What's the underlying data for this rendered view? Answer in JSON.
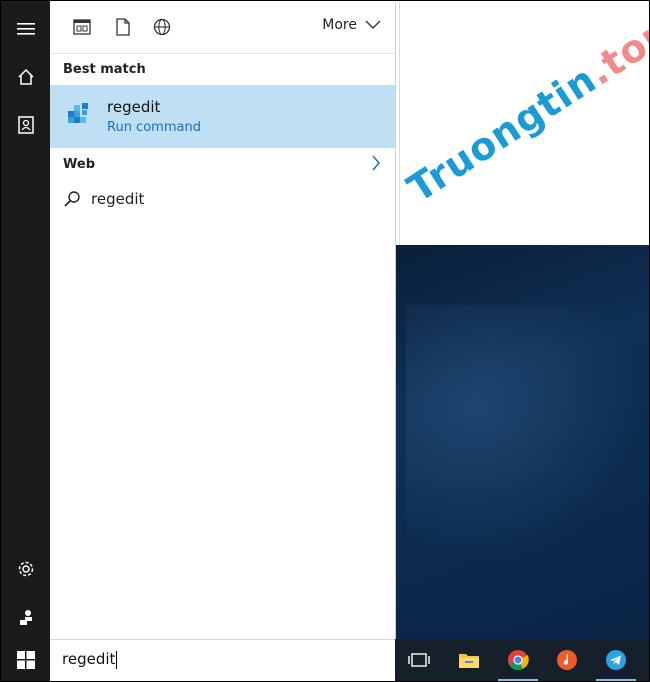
{
  "rail": {
    "items": [
      "menu-icon",
      "home-icon",
      "notebook-icon",
      "settings-icon",
      "feedback-icon"
    ]
  },
  "toolbar": {
    "filters": [
      "apps-filter-icon",
      "documents-filter-icon",
      "web-filter-icon"
    ],
    "more_label": "More"
  },
  "results": {
    "best_match_heading": "Best match",
    "best_match": {
      "title": "regedit",
      "subtitle": "Run command"
    },
    "web_heading": "Web",
    "suggestion": "regedit"
  },
  "search": {
    "value": "regedit"
  },
  "watermark": {
    "part1": "Truongtin",
    "part2": ".top"
  },
  "taskbar": {
    "apps": [
      "task-view-icon",
      "file-explorer-icon",
      "chrome-icon",
      "music-app-icon",
      "telegram-icon"
    ]
  },
  "colors": {
    "rail_bg": "#1b1b1b",
    "best_match_bg": "#bfdff4",
    "accent": "#1a6fc2",
    "taskbar_bg": "#16202b"
  }
}
